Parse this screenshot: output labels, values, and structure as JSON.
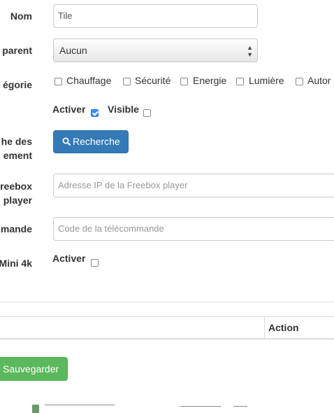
{
  "form": {
    "name_label": "Nom",
    "name_value": "Tile",
    "parent_label": "parent",
    "parent_value": "Aucun",
    "category_label": "égorie",
    "categories": [
      "Chauffage",
      "Sécurité",
      "Energie",
      "Lumière",
      "Autor"
    ],
    "activate_label": "Activer",
    "activate_checked": true,
    "visible_label": "Visible",
    "visible_checked": false,
    "search_label_line1": "he des",
    "search_label_line2": "ement",
    "search_button": "Recherche",
    "freebox_label_line1": "reebox",
    "freebox_label_line2": "player",
    "freebox_placeholder": "Adresse IP de la Freebox player",
    "remote_label": "mande",
    "remote_placeholder": "Code de la télécommande",
    "mini4k_label": "Mini 4k",
    "mini4k_activate_label": "Activer",
    "mini4k_checked": false
  },
  "table": {
    "action_header": "Action"
  },
  "footer": {
    "save_button": "Sauvegarder"
  },
  "colors": {
    "primary": "#337ab7",
    "success": "#5cb85c",
    "checkbox_checked": "#3d8ef0"
  }
}
